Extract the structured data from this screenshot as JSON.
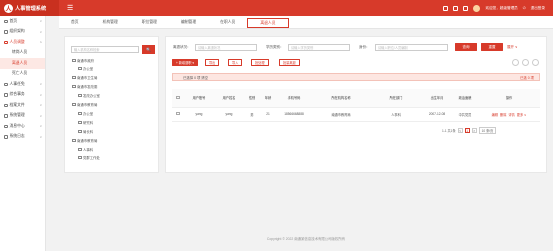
{
  "header": {
    "app_title": "人事管理系统",
    "logo_char": "人",
    "user_text": "欢迎您，超级管理员",
    "logout": "退出登录"
  },
  "sidebar": {
    "items": [
      {
        "label": "首页",
        "level": "top"
      },
      {
        "label": "组织架构",
        "level": "top"
      },
      {
        "label": "人员调整",
        "level": "parent"
      },
      {
        "label": "转岗人员",
        "level": "sub"
      },
      {
        "label": "离退人员",
        "level": "sub",
        "active": true
      },
      {
        "label": "死亡人员",
        "level": "sub"
      },
      {
        "label": "人事任免",
        "level": "top"
      },
      {
        "label": "综合事务",
        "level": "top"
      },
      {
        "label": "档案文件",
        "level": "top"
      },
      {
        "label": "系统管理",
        "level": "top"
      },
      {
        "label": "消息中心",
        "level": "top"
      },
      {
        "label": "系统日志",
        "level": "top"
      }
    ]
  },
  "tabs": [
    "首页",
    "机构管理",
    "职位管理",
    "编制管理",
    "在职人员",
    "离退人员"
  ],
  "active_tab": "离退人员",
  "tree": {
    "search_placeholder": "输入机构名称检索",
    "search_btn": "🔍",
    "nodes": [
      {
        "label": "南通市政府",
        "indent": 0
      },
      {
        "label": "办公室",
        "indent": 1
      },
      {
        "label": "南通市卫生局",
        "indent": 0
      },
      {
        "label": "南通市发改委",
        "indent": 0
      },
      {
        "label": "发改办公室",
        "indent": 1
      },
      {
        "label": "南通市教育局",
        "indent": 0
      },
      {
        "label": "办公室",
        "indent": 1
      },
      {
        "label": "研究科",
        "indent": 1
      },
      {
        "label": "局长科",
        "indent": 1
      },
      {
        "label": "南通市教育局",
        "indent": 0
      },
      {
        "label": "人事科",
        "indent": 1
      },
      {
        "label": "党群工作处",
        "indent": 1
      }
    ]
  },
  "filters": {
    "name_label": "离退状况：",
    "name_placeholder": "请输入离退状况",
    "edu_label": "学历类别：",
    "edu_placeholder": "请输入学历类别",
    "id_label": "身份：",
    "id_placeholder": "请输入职位/人员编制",
    "search_btn": "查询",
    "reset_btn": "重置",
    "expand": "展开 ∨"
  },
  "toolbar": {
    "add": "+ 新增退职 ▾",
    "export": "导出",
    "import": "导入",
    "batch1": "批处理",
    "batch2": "批量离退"
  },
  "alert": {
    "text": "已选择 0 项   清空",
    "right": "已选 0 项"
  },
  "table": {
    "headers": [
      "",
      "用户账号",
      "用户姓名",
      "性别",
      "年龄",
      "手机号码",
      "所在机构名称",
      "所在部门",
      "出生年月",
      "政治面貌",
      "操作"
    ],
    "rows": [
      {
        "account": "yang",
        "name": "yang",
        "gender": "男",
        "age": "21",
        "phone": "18566668888",
        "org": "南通市教育局",
        "dept": "人事科",
        "birth": "2007-12-08",
        "political": "中共党员",
        "ops": [
          "编辑",
          "删除",
          "详情",
          "更多 ∨"
        ]
      }
    ],
    "ops_header": "操作"
  },
  "pager": {
    "total": "1-1 共1条",
    "prev": "<",
    "page": "1",
    "next": ">",
    "size": "10 条/页"
  },
  "footer": "Copyright © 2022 南通某信息技术有限公司版权所有"
}
